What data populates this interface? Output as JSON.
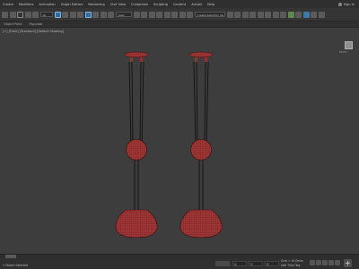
{
  "menubar": {
    "items": [
      "Create",
      "Modifiers",
      "Animation",
      "Graph Editors",
      "Rendering",
      "Civil View",
      "Customize",
      "Scripting",
      "Content",
      "Arnold",
      "Help"
    ],
    "signin": "Sign In"
  },
  "toolbar": {
    "view_dropdown": "View",
    "selection_set": "Create Selection Se"
  },
  "ribbon": {
    "items": [
      "Object Paint",
      "Populate"
    ]
  },
  "viewport": {
    "label": "[+] [Front] [Standard] [Default Shading]",
    "viewcube_label": "FRONT",
    "mesh_color": "#a83a3a",
    "background": "#3d3d3d"
  },
  "status": {
    "selection": "1 Object Selected",
    "x_value": "X:",
    "y_value": "Y:",
    "z_value": "Z:",
    "grid": "Grid = 10.0mm",
    "add_time_tag": "Add Time Tag"
  }
}
